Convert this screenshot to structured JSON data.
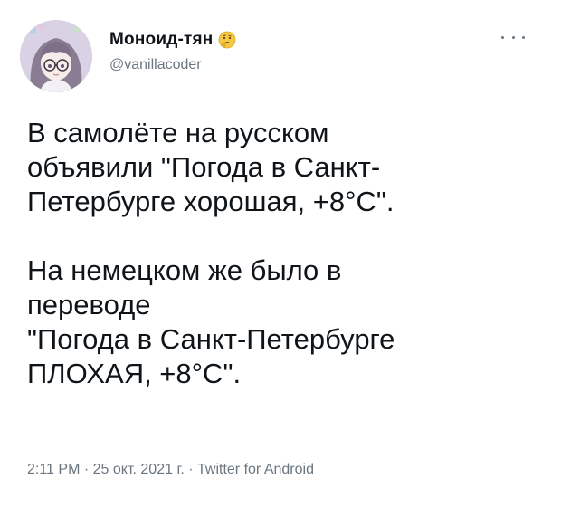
{
  "tweet": {
    "author": {
      "display_name": "Моноид-тян",
      "handle": "@vanillacoder",
      "badge_icon": "thinking-face-emoji-icon",
      "avatar": "anime-girl-avatar"
    },
    "more_icon": "more-options-icon",
    "text_paragraph_1": "В самолёте на русском\nобъявили \"Погода в Санкт-\nПетербурге хорошая, +8°C\".",
    "text_paragraph_2": "На немецком же было в\nпереводе\n\"Погода в Санкт-Петербурге\nПЛОХАЯ, +8°C\".",
    "meta": {
      "time": "2:11 PM",
      "separator": "·",
      "date": "25 окт. 2021 г.",
      "client": "Twitter for Android"
    }
  },
  "colors": {
    "text_primary": "#0f1419",
    "text_secondary": "#6b7680",
    "background": "#ffffff"
  }
}
